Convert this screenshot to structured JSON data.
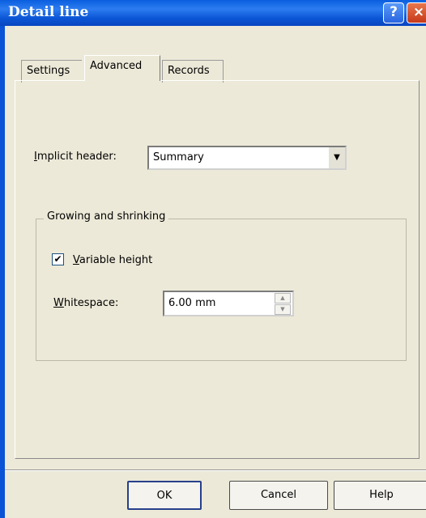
{
  "window": {
    "title": "Detail line",
    "help_icon": "?",
    "close_icon": "×"
  },
  "tabs": [
    {
      "label": "Settings"
    },
    {
      "label": "Advanced"
    },
    {
      "label": "Records"
    }
  ],
  "implicit_header": {
    "label_prefix": "I",
    "label_rest": "mplicit header:",
    "value": "Summary"
  },
  "group": {
    "title": "Growing and shrinking",
    "variable_height": {
      "checked": true,
      "label_prefix": "V",
      "label_rest": "ariable height"
    },
    "whitespace": {
      "label_prefix": "W",
      "label_rest": "hitespace:",
      "value": "6.00 mm"
    }
  },
  "buttons": {
    "ok": "OK",
    "cancel": "Cancel",
    "help": "Help"
  }
}
